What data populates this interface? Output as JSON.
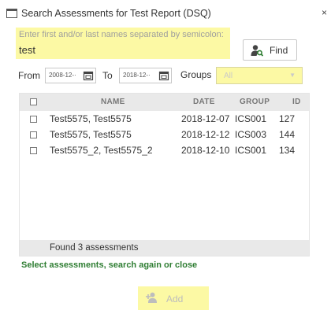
{
  "window": {
    "title": "Search Assessments for Test Report (DSQ)",
    "close_glyph": "×"
  },
  "search": {
    "hint": "Enter first and/or last names separated by semicolon:",
    "value": "test",
    "find_label": "Find",
    "find_icon": "user-search-icon"
  },
  "filters": {
    "from_label": "From",
    "from_value": "2008-12-·",
    "to_label": "To",
    "to_value": "2018-12-·",
    "groups_label": "Groups",
    "groups_value": "All"
  },
  "grid": {
    "columns": [
      "NAME",
      "DATE",
      "GROUP",
      "ID"
    ],
    "rows": [
      {
        "name": "Test5575, Test5575",
        "date": "2018-12-07",
        "group": "ICS001",
        "id": "127"
      },
      {
        "name": "Test5575, Test5575",
        "date": "2018-12-12",
        "group": "ICS003",
        "id": "144"
      },
      {
        "name": "Test5575_2, Test5575_2",
        "date": "2018-12-10",
        "group": "ICS001",
        "id": "134"
      }
    ],
    "footer": "Found 3 assessments"
  },
  "status": "Select assessments, search again or close",
  "add": {
    "label": "Add",
    "icon": "add-user-icon"
  },
  "colors": {
    "highlight": "#fcf9a4",
    "status_green": "#2e7d32",
    "header_gray": "#e9e9e9"
  }
}
